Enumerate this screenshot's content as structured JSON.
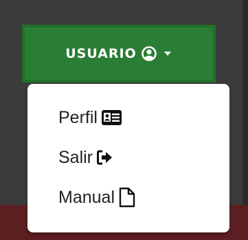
{
  "user_button": {
    "label": "USUARIO",
    "icon": "user-circle-icon",
    "caret_icon": "caret-down-icon"
  },
  "menu": {
    "items": [
      {
        "label": "Perfil",
        "icon": "id-card-icon"
      },
      {
        "label": "Salir",
        "icon": "sign-out-icon"
      },
      {
        "label": "Manual",
        "icon": "file-icon"
      }
    ]
  },
  "colors": {
    "button_bg": "#2b7d35",
    "page_bg": "#3b3b3b",
    "bottom_band": "#5b1f22",
    "menu_bg": "#ffffff",
    "text": "#222222"
  }
}
